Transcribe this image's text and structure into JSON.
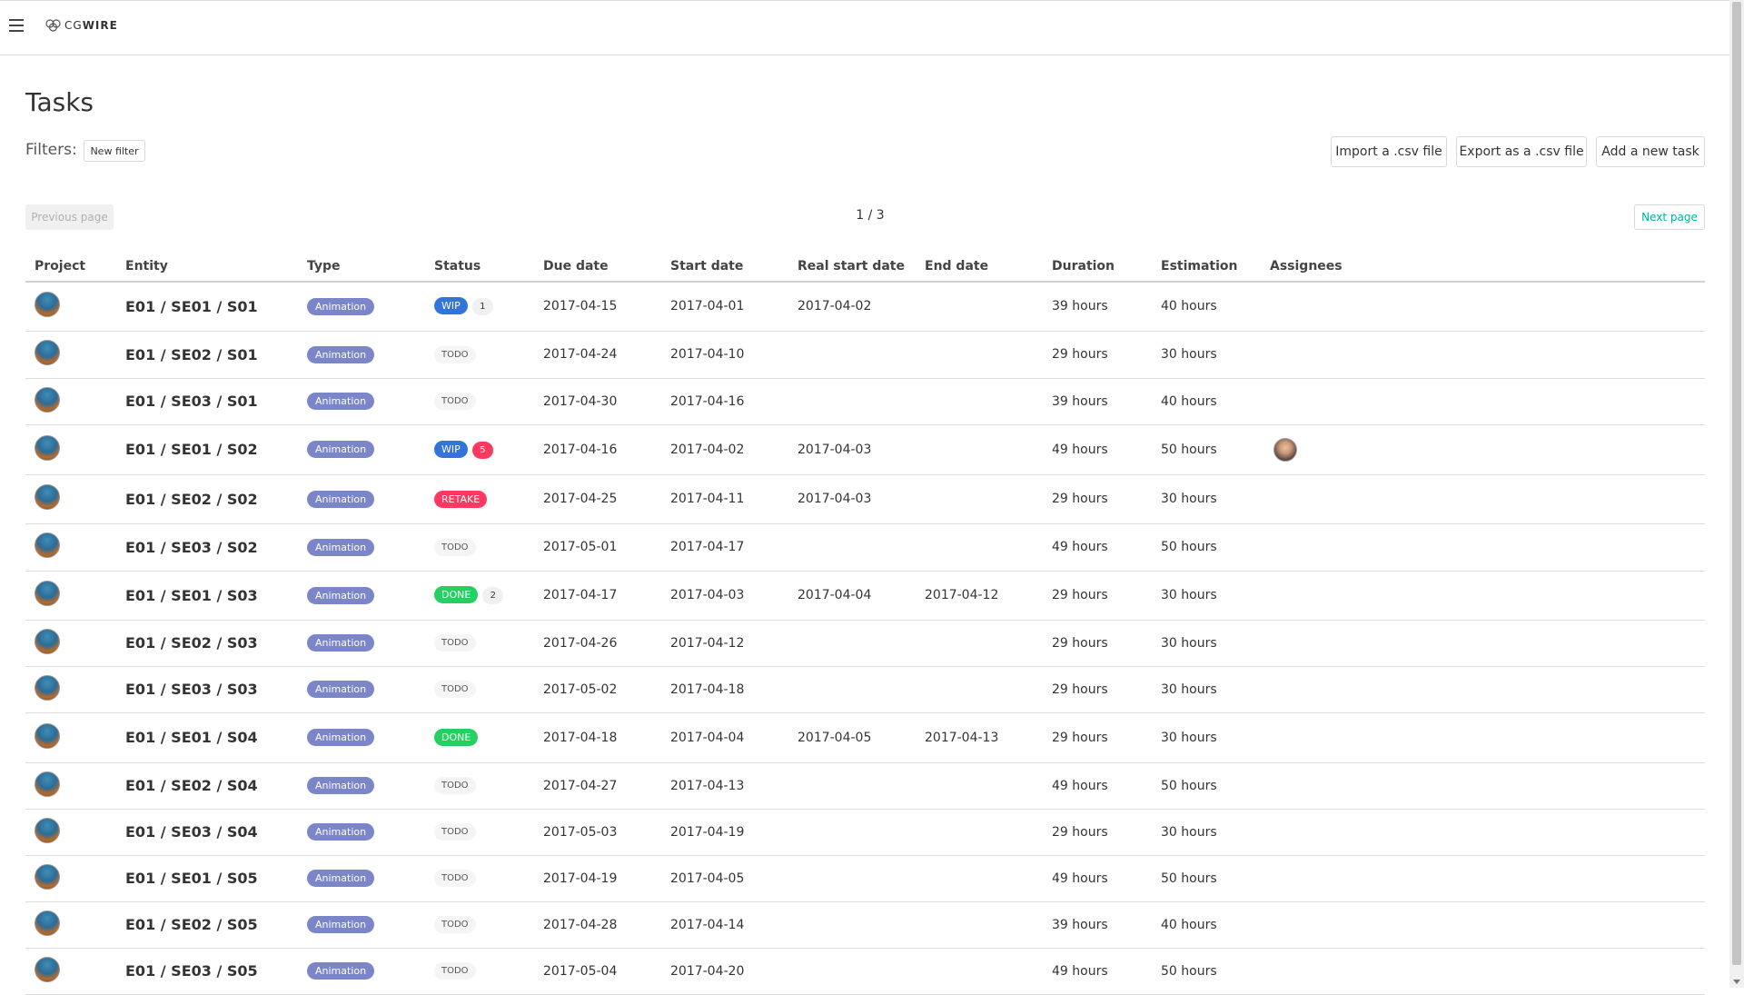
{
  "app": {
    "logo_prefix": "CG",
    "logo_suffix": "WIRE"
  },
  "page": {
    "title": "Tasks",
    "filters_label": "Filters:",
    "new_filter_label": "New filter",
    "import_label": "Import a .csv file",
    "export_label": "Export as a .csv file",
    "add_task_label": "Add a new task"
  },
  "pagination": {
    "prev_label": "Previous page",
    "next_label": "Next page",
    "indicator": "1 / 3"
  },
  "table": {
    "columns": [
      "Project",
      "Entity",
      "Type",
      "Status",
      "Due date",
      "Start date",
      "Real start date",
      "End date",
      "Duration",
      "Estimation",
      "Assignees"
    ],
    "rows": [
      {
        "entity": "E01 / SE01 / S01",
        "type": "Animation",
        "status": "WIP",
        "status_kind": "wip",
        "comments": "1",
        "comment_alert": false,
        "due": "2017-04-15",
        "due_late": false,
        "start": "2017-04-01",
        "real_start": "2017-04-02",
        "end": "",
        "duration": "39 hours",
        "estimation": "40 hours",
        "has_assignee": false
      },
      {
        "entity": "E01 / SE02 / S01",
        "type": "Animation",
        "status": "TODO",
        "status_kind": "todo",
        "comments": "",
        "comment_alert": false,
        "due": "2017-04-24",
        "due_late": false,
        "start": "2017-04-10",
        "real_start": "",
        "end": "",
        "duration": "29 hours",
        "estimation": "30 hours",
        "has_assignee": false
      },
      {
        "entity": "E01 / SE03 / S01",
        "type": "Animation",
        "status": "TODO",
        "status_kind": "todo",
        "comments": "",
        "comment_alert": false,
        "due": "2017-04-30",
        "due_late": false,
        "start": "2017-04-16",
        "real_start": "",
        "end": "",
        "duration": "39 hours",
        "estimation": "40 hours",
        "has_assignee": false
      },
      {
        "entity": "E01 / SE01 / S02",
        "type": "Animation",
        "status": "WIP",
        "status_kind": "wip",
        "comments": "5",
        "comment_alert": true,
        "due": "2017-04-16",
        "due_late": true,
        "start": "2017-04-02",
        "real_start": "2017-04-03",
        "end": "",
        "duration": "49 hours",
        "estimation": "50 hours",
        "has_assignee": true
      },
      {
        "entity": "E01 / SE02 / S02",
        "type": "Animation",
        "status": "RETAKE",
        "status_kind": "retake",
        "comments": "",
        "comment_alert": false,
        "due": "2017-04-25",
        "due_late": false,
        "start": "2017-04-11",
        "real_start": "2017-04-03",
        "end": "",
        "duration": "29 hours",
        "estimation": "30 hours",
        "has_assignee": false
      },
      {
        "entity": "E01 / SE03 / S02",
        "type": "Animation",
        "status": "TODO",
        "status_kind": "todo",
        "comments": "",
        "comment_alert": false,
        "due": "2017-05-01",
        "due_late": false,
        "start": "2017-04-17",
        "real_start": "",
        "end": "",
        "duration": "49 hours",
        "estimation": "50 hours",
        "has_assignee": false
      },
      {
        "entity": "E01 / SE01 / S03",
        "type": "Animation",
        "status": "DONE",
        "status_kind": "done",
        "comments": "2",
        "comment_alert": false,
        "due": "2017-04-17",
        "due_late": false,
        "start": "2017-04-03",
        "real_start": "2017-04-04",
        "end": "2017-04-12",
        "duration": "29 hours",
        "estimation": "30 hours",
        "has_assignee": false
      },
      {
        "entity": "E01 / SE02 / S03",
        "type": "Animation",
        "status": "TODO",
        "status_kind": "todo",
        "comments": "",
        "comment_alert": false,
        "due": "2017-04-26",
        "due_late": false,
        "start": "2017-04-12",
        "real_start": "",
        "end": "",
        "duration": "29 hours",
        "estimation": "30 hours",
        "has_assignee": false
      },
      {
        "entity": "E01 / SE03 / S03",
        "type": "Animation",
        "status": "TODO",
        "status_kind": "todo",
        "comments": "",
        "comment_alert": false,
        "due": "2017-05-02",
        "due_late": false,
        "start": "2017-04-18",
        "real_start": "",
        "end": "",
        "duration": "29 hours",
        "estimation": "30 hours",
        "has_assignee": false
      },
      {
        "entity": "E01 / SE01 / S04",
        "type": "Animation",
        "status": "DONE",
        "status_kind": "done",
        "comments": "",
        "comment_alert": false,
        "due": "2017-04-18",
        "due_late": false,
        "start": "2017-04-04",
        "real_start": "2017-04-05",
        "end": "2017-04-13",
        "duration": "29 hours",
        "estimation": "30 hours",
        "has_assignee": false
      },
      {
        "entity": "E01 / SE02 / S04",
        "type": "Animation",
        "status": "TODO",
        "status_kind": "todo",
        "comments": "",
        "comment_alert": false,
        "due": "2017-04-27",
        "due_late": false,
        "start": "2017-04-13",
        "real_start": "",
        "end": "",
        "duration": "49 hours",
        "estimation": "50 hours",
        "has_assignee": false
      },
      {
        "entity": "E01 / SE03 / S04",
        "type": "Animation",
        "status": "TODO",
        "status_kind": "todo",
        "comments": "",
        "comment_alert": false,
        "due": "2017-05-03",
        "due_late": false,
        "start": "2017-04-19",
        "real_start": "",
        "end": "",
        "duration": "29 hours",
        "estimation": "30 hours",
        "has_assignee": false
      },
      {
        "entity": "E01 / SE01 / S05",
        "type": "Animation",
        "status": "TODO",
        "status_kind": "todo",
        "comments": "",
        "comment_alert": false,
        "due": "2017-04-19",
        "due_late": false,
        "start": "2017-04-05",
        "real_start": "",
        "end": "",
        "duration": "49 hours",
        "estimation": "50 hours",
        "has_assignee": false
      },
      {
        "entity": "E01 / SE02 / S05",
        "type": "Animation",
        "status": "TODO",
        "status_kind": "todo",
        "comments": "",
        "comment_alert": false,
        "due": "2017-04-28",
        "due_late": false,
        "start": "2017-04-14",
        "real_start": "",
        "end": "",
        "duration": "39 hours",
        "estimation": "40 hours",
        "has_assignee": false
      },
      {
        "entity": "E01 / SE03 / S05",
        "type": "Animation",
        "status": "TODO",
        "status_kind": "todo",
        "comments": "",
        "comment_alert": false,
        "due": "2017-05-04",
        "due_late": false,
        "start": "2017-04-20",
        "real_start": "",
        "end": "",
        "duration": "49 hours",
        "estimation": "50 hours",
        "has_assignee": false
      }
    ]
  }
}
